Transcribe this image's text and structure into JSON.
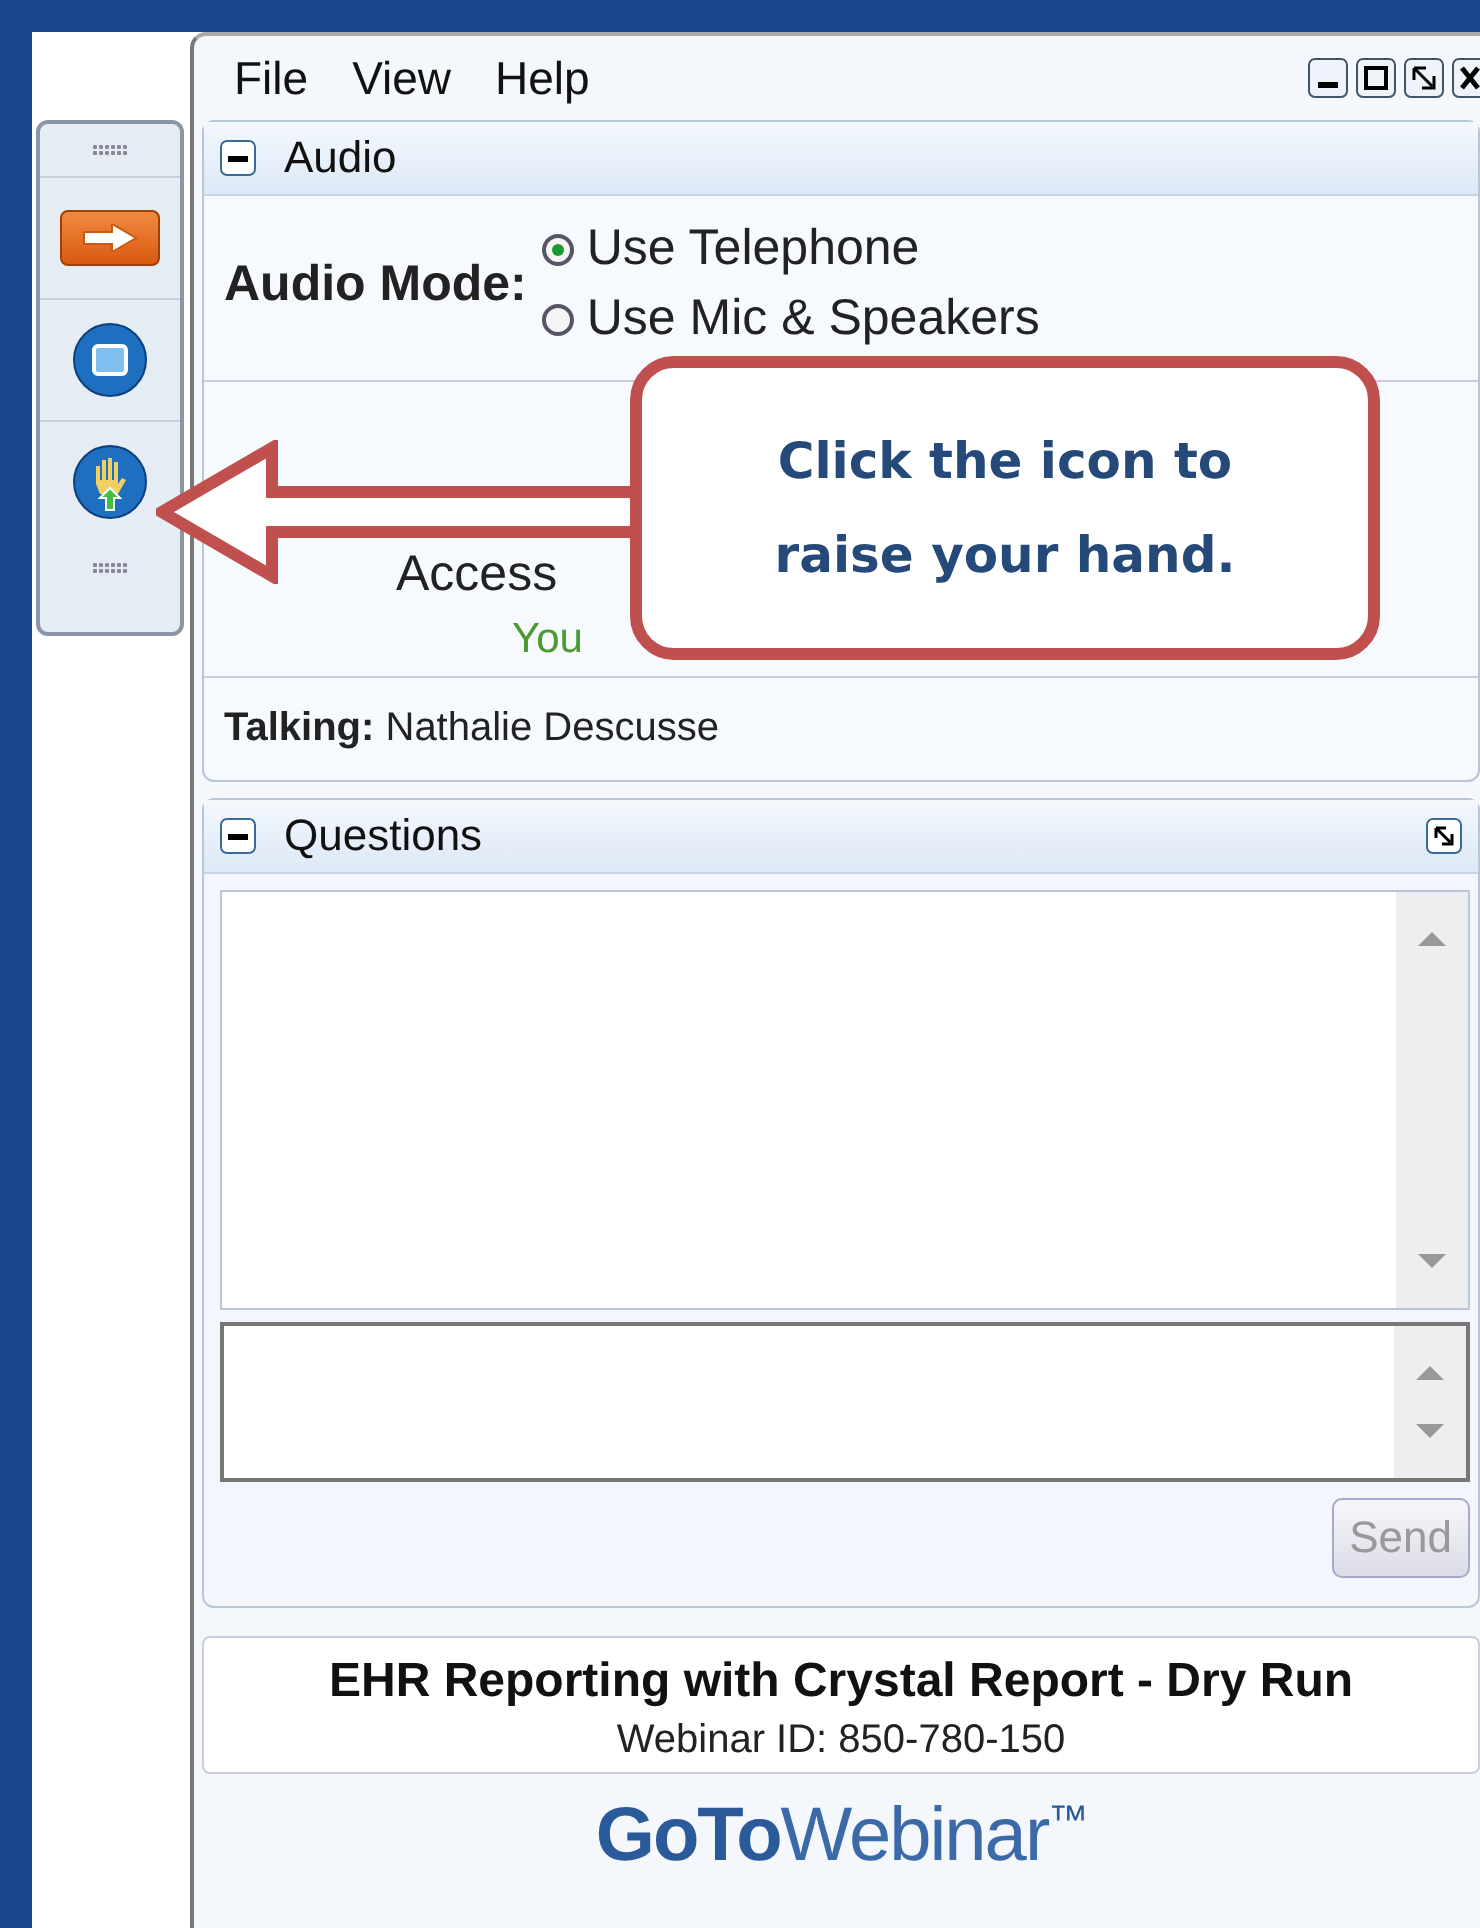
{
  "menu": [
    "File",
    "View",
    "Help"
  ],
  "toolbar": [
    {
      "kind": "arrow"
    },
    {
      "kind": "screen"
    },
    {
      "kind": "hand"
    }
  ],
  "audio": {
    "title": "Audio",
    "mode_label": "Audio Mode:",
    "options": [
      {
        "label": "Use Telephone",
        "selected": true
      },
      {
        "label": "Use Mic & Speakers",
        "selected": false
      }
    ],
    "access_label": "Access",
    "status": "You",
    "talking_label": "Talking:",
    "talking_name": "Nathalie Descusse"
  },
  "questions": {
    "title": "Questions",
    "send": "Send",
    "send_disabled": true
  },
  "footer": {
    "title": "EHR Reporting with Crystal Report - Dry Run",
    "webinar_id": "Webinar ID: 850-780-150",
    "logo_bold": "GoTo",
    "logo_light": "Webinar",
    "logo_mark": "™"
  },
  "callout": {
    "lines": [
      "Click the icon to",
      "raise your hand."
    ]
  }
}
